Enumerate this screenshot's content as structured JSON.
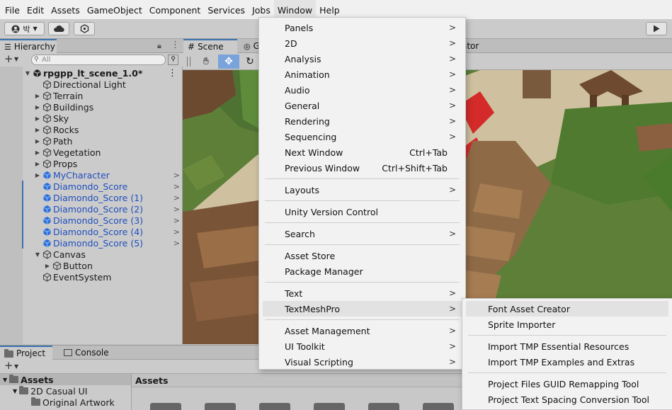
{
  "menubar": {
    "items": [
      "File",
      "Edit",
      "Assets",
      "GameObject",
      "Component",
      "Services",
      "Jobs",
      "Window",
      "Help"
    ],
    "active": "Window"
  },
  "toolbar": {
    "account_label": "박",
    "play_icon": "play-icon"
  },
  "hierarchy": {
    "tab_label": "Hierarchy",
    "search_placeholder": "All",
    "scene_name": "rpgpp_lt_scene_1.0*",
    "items": [
      {
        "label": "Directional Light",
        "depth": 1,
        "arrow": false,
        "blue": false,
        "chev": false
      },
      {
        "label": "Terrain",
        "depth": 1,
        "arrow": true,
        "blue": false,
        "chev": false
      },
      {
        "label": "Buildings",
        "depth": 1,
        "arrow": true,
        "blue": false,
        "chev": false
      },
      {
        "label": "Sky",
        "depth": 1,
        "arrow": true,
        "blue": false,
        "chev": false
      },
      {
        "label": "Rocks",
        "depth": 1,
        "arrow": true,
        "blue": false,
        "chev": false
      },
      {
        "label": "Path",
        "depth": 1,
        "arrow": true,
        "blue": false,
        "chev": false
      },
      {
        "label": "Vegetation",
        "depth": 1,
        "arrow": true,
        "blue": false,
        "chev": false
      },
      {
        "label": "Props",
        "depth": 1,
        "arrow": true,
        "blue": false,
        "chev": false
      },
      {
        "label": "MyCharacter",
        "depth": 1,
        "arrow": true,
        "blue": true,
        "chev": true
      },
      {
        "label": "Diamondo_Score",
        "depth": 1,
        "arrow": false,
        "blue": true,
        "chev": true
      },
      {
        "label": "Diamondo_Score (1)",
        "depth": 1,
        "arrow": false,
        "blue": true,
        "chev": true
      },
      {
        "label": "Diamondo_Score (2)",
        "depth": 1,
        "arrow": false,
        "blue": true,
        "chev": true
      },
      {
        "label": "Diamondo_Score (3)",
        "depth": 1,
        "arrow": false,
        "blue": true,
        "chev": true
      },
      {
        "label": "Diamondo_Score (4)",
        "depth": 1,
        "arrow": false,
        "blue": true,
        "chev": true
      },
      {
        "label": "Diamondo_Score (5)",
        "depth": 1,
        "arrow": false,
        "blue": true,
        "chev": true
      },
      {
        "label": "Canvas",
        "depth": 1,
        "arrow": true,
        "expanded": true,
        "blue": false,
        "chev": false
      },
      {
        "label": "Button",
        "depth": 2,
        "arrow": true,
        "blue": false,
        "chev": false
      },
      {
        "label": "EventSystem",
        "depth": 1,
        "arrow": false,
        "blue": false,
        "chev": false
      }
    ]
  },
  "scene": {
    "tab_label": "Scene",
    "tab_game_partial": "G",
    "tab_animator_partial": "ator"
  },
  "bottom": {
    "project_tab": "Project",
    "console_tab": "Console",
    "tree": [
      "Assets",
      "2D Casual UI",
      "Original Artwork"
    ],
    "assets_header": "Assets"
  },
  "window_menu": {
    "items": [
      {
        "label": "Panels",
        "submenu": true
      },
      {
        "label": "2D",
        "submenu": true
      },
      {
        "label": "Analysis",
        "submenu": true
      },
      {
        "label": "Animation",
        "submenu": true
      },
      {
        "label": "Audio",
        "submenu": true
      },
      {
        "label": "General",
        "submenu": true
      },
      {
        "label": "Rendering",
        "submenu": true
      },
      {
        "label": "Sequencing",
        "submenu": true
      },
      {
        "label": "Next Window",
        "shortcut": "Ctrl+Tab"
      },
      {
        "label": "Previous Window",
        "shortcut": "Ctrl+Shift+Tab"
      },
      {
        "sep": true
      },
      {
        "label": "Layouts",
        "submenu": true
      },
      {
        "sep": true
      },
      {
        "label": "Unity Version Control"
      },
      {
        "sep": true
      },
      {
        "label": "Search",
        "submenu": true
      },
      {
        "sep": true
      },
      {
        "label": "Asset Store"
      },
      {
        "label": "Package Manager"
      },
      {
        "sep": true
      },
      {
        "label": "Text",
        "submenu": true
      },
      {
        "label": "TextMeshPro",
        "submenu": true,
        "highlighted": true
      },
      {
        "sep": true
      },
      {
        "label": "Asset Management",
        "submenu": true
      },
      {
        "label": "UI Toolkit",
        "submenu": true
      },
      {
        "label": "Visual Scripting",
        "submenu": true
      }
    ]
  },
  "tmp_submenu": {
    "items": [
      {
        "label": "Font Asset Creator",
        "highlighted": true
      },
      {
        "label": "Sprite Importer"
      },
      {
        "sep": true
      },
      {
        "label": "Import TMP Essential Resources"
      },
      {
        "label": "Import TMP Examples and Extras"
      },
      {
        "sep": true
      },
      {
        "label": "Project Files GUID Remapping Tool"
      },
      {
        "label": "Project Text Spacing Conversion Tool"
      }
    ]
  }
}
